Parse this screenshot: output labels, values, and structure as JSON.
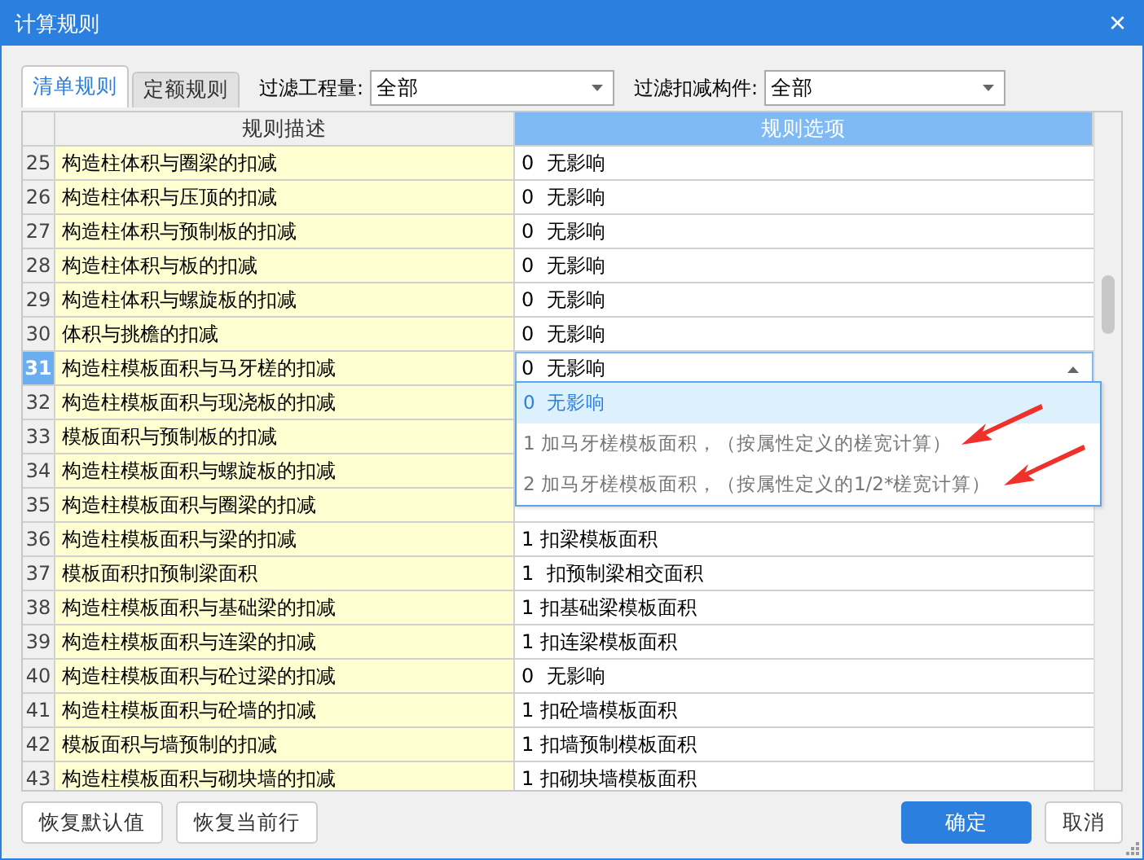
{
  "window": {
    "title": "计算规则",
    "close": "×"
  },
  "tabs": [
    {
      "label": "清单规则",
      "selected": true
    },
    {
      "label": "定额规则",
      "selected": false
    }
  ],
  "filters": [
    {
      "label": "过滤工程量:",
      "value": "全部"
    },
    {
      "label": "过滤扣减构件:",
      "value": "全部"
    }
  ],
  "table": {
    "columns": [
      "规则描述",
      "规则选项"
    ],
    "rows": [
      {
        "number": "25",
        "description": "构造柱体积与圈梁的扣减",
        "option": "0  无影响",
        "selected": false
      },
      {
        "number": "26",
        "description": "构造柱体积与压顶的扣减",
        "option": "0  无影响",
        "selected": false
      },
      {
        "number": "27",
        "description": "构造柱体积与预制板的扣减",
        "option": "0  无影响",
        "selected": false
      },
      {
        "number": "28",
        "description": "构造柱体积与板的扣减",
        "option": "0  无影响",
        "selected": false
      },
      {
        "number": "29",
        "description": "构造柱体积与螺旋板的扣减",
        "option": "0  无影响",
        "selected": false
      },
      {
        "number": "30",
        "description": "体积与挑檐的扣减",
        "option": "0  无影响",
        "selected": false
      },
      {
        "number": "31",
        "description": "构造柱模板面积与马牙槎的扣减",
        "option": "0  无影响",
        "selected": true
      },
      {
        "number": "32",
        "description": "构造柱模板面积与现浇板的扣减",
        "selected": false
      },
      {
        "number": "33",
        "description": "模板面积与预制板的扣减",
        "selected": false
      },
      {
        "number": "34",
        "description": "构造柱模板面积与螺旋板的扣减",
        "selected": false
      },
      {
        "number": "35",
        "description": "构造柱模板面积与圈梁的扣减",
        "selected": false
      },
      {
        "number": "36",
        "description": "构造柱模板面积与梁的扣减",
        "option": "1 扣梁模板面积",
        "selected": false
      },
      {
        "number": "37",
        "description": "模板面积扣预制梁面积",
        "option": "1  扣预制梁相交面积",
        "selected": false
      },
      {
        "number": "38",
        "description": "构造柱模板面积与基础梁的扣减",
        "option": "1 扣基础梁模板面积",
        "selected": false
      },
      {
        "number": "39",
        "description": "构造柱模板面积与连梁的扣减",
        "option": "1 扣连梁模板面积",
        "selected": false
      },
      {
        "number": "40",
        "description": "构造柱模板面积与砼过梁的扣减",
        "option": "0  无影响",
        "selected": false
      },
      {
        "number": "41",
        "description": "构造柱模板面积与砼墙的扣减",
        "option": "1 扣砼墙模板面积",
        "selected": false
      },
      {
        "number": "42",
        "description": "模板面积与墙预制的扣减",
        "option": "1 扣墙预制模板面积",
        "selected": false
      },
      {
        "number": "43",
        "description": "构造柱模板面积与砌块墙的扣减",
        "option": "1 扣砌块墙模板面积",
        "selected": false
      }
    ]
  },
  "dropdown": {
    "options": [
      {
        "label": "0  无影响",
        "selected": true,
        "annotated": false
      },
      {
        "label": "1 加马牙槎模板面积，（按属性定义的槎宽计算）",
        "selected": false,
        "annotated": true
      },
      {
        "label": "2 加马牙槎模板面积，（按属性定义的1/2*槎宽计算）",
        "selected": false,
        "annotated": true
      }
    ]
  },
  "buttons": [
    {
      "label": "恢复默认值",
      "kind": "plain"
    },
    {
      "label": "恢复当前行",
      "kind": "plain"
    },
    {
      "label": "确定",
      "kind": "primary"
    },
    {
      "label": "取消",
      "kind": "plain"
    }
  ]
}
